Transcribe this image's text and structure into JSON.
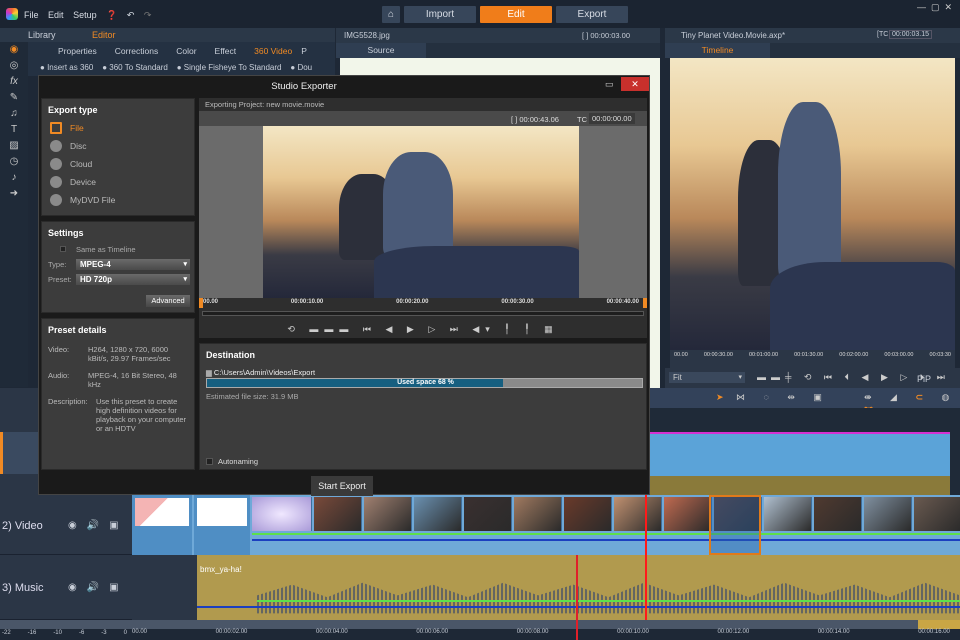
{
  "app": {
    "menu": [
      "File",
      "Edit",
      "Setup"
    ],
    "modes": [
      {
        "label": "Import"
      },
      {
        "label": "Edit",
        "active": true
      },
      {
        "label": "Export"
      }
    ],
    "accent": "#f07d1a"
  },
  "left": {
    "library": "Library",
    "editor": "Editor",
    "tabs": [
      "Properties",
      "Corrections",
      "Color",
      "Effect",
      "360 Video",
      "P"
    ],
    "active_tab": "360 Video",
    "steps": [
      {
        "n": "1",
        "label": "Insert as 360"
      },
      {
        "n": "2",
        "label": "360 To Standard"
      },
      {
        "n": "3",
        "label": "Single Fisheye To Standard"
      },
      {
        "n": "4",
        "label": "Dou"
      }
    ]
  },
  "source": {
    "file": "IMG5528.jpg",
    "timecode": "[ ] 00:00:03.00",
    "tab": "Source"
  },
  "timeline_preview": {
    "file": "Tiny Planet Video.Movie.axp*",
    "tc_label": "[TC",
    "timecode": "00:00:03.15",
    "tab": "Timeline",
    "ruler": [
      "00.00",
      "00:00:30.00",
      "00:01:00.00",
      "00:01:30.00",
      "00:02:00.00",
      "00:03:00.00",
      "00:03:30"
    ],
    "zoom": "Fit",
    "pip": "PiP"
  },
  "dialog": {
    "title": "Studio Exporter",
    "export_type": {
      "title": "Export type",
      "items": [
        {
          "label": "File",
          "icon": "file-icon",
          "active": true
        },
        {
          "label": "Disc",
          "icon": "disc-icon"
        },
        {
          "label": "Cloud",
          "icon": "cloud-icon"
        },
        {
          "label": "Device",
          "icon": "device-icon"
        },
        {
          "label": "MyDVD File",
          "icon": "mydvd-icon"
        }
      ]
    },
    "settings": {
      "title": "Settings",
      "same_as_timeline": "Same as Timeline",
      "type_label": "Type:",
      "type_value": "MPEG-4",
      "preset_label": "Preset:",
      "preset_value": "HD 720p",
      "advanced": "Advanced"
    },
    "preset_details": {
      "title": "Preset details",
      "rows": [
        {
          "k": "Video:",
          "v": "H264, 1280 x 720, 6000 kBit/s, 29.97 Frames/sec"
        },
        {
          "k": "Audio:",
          "v": "MPEG-4, 16 Bit Stereo, 48 kHz"
        },
        {
          "k": "Description:",
          "v": "Use this preset to create high definition videos for playback on your computer or an HDTV"
        }
      ]
    },
    "project": "Exporting Project: new movie.movie",
    "duration": "[ ] 00:00:43.06",
    "tc_label": "TC",
    "tc_value": "00:00:00.00",
    "ruler": [
      "00.00",
      "00:00:10.00",
      "00:00:20.00",
      "00:00:30.00",
      "00:00:40.00"
    ],
    "destination": {
      "title": "Destination",
      "path": "C:\\Users\\Admin\\Videos\\Export",
      "used_space_label": "Used space 68 %",
      "used_space_pct": 68,
      "estimated": "Estimated file size: 31.9 MB",
      "autonaming": "Autonaming"
    },
    "start_export": "Start Export"
  },
  "tracks": [
    {
      "label": "2) Video"
    },
    {
      "label": "3) Music",
      "clip": "bmx_ya-ha!"
    }
  ],
  "timeline_ruler": [
    "00.00",
    "00:00:02.00",
    "00:00:04.00",
    "00:00:06.00",
    "00:00:08.00",
    "00:00:10.00",
    "00:00:12.00",
    "00:00:14.00",
    "00:00:16.00"
  ],
  "meter": [
    "-22",
    "-16",
    "-10",
    "-6",
    "-3",
    "0"
  ]
}
